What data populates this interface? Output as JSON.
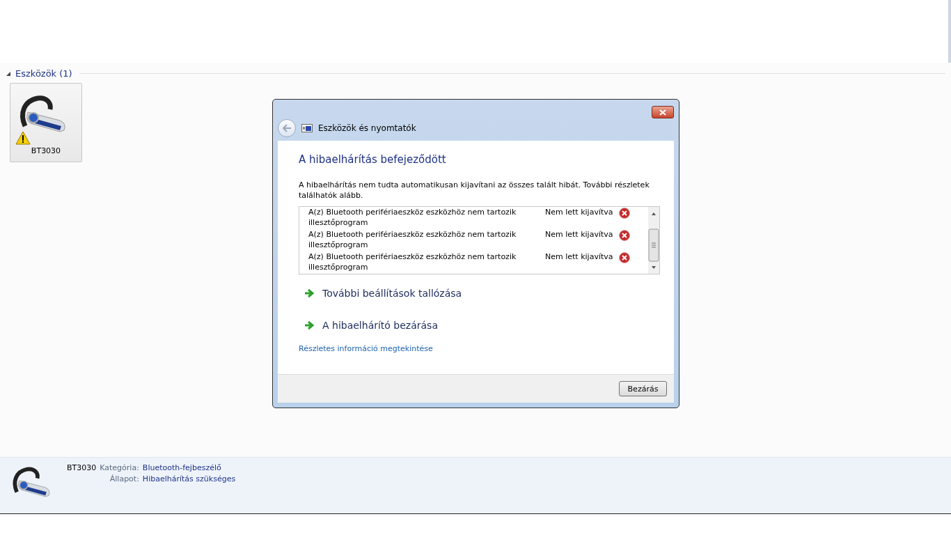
{
  "group": {
    "title": "Eszközök (1)",
    "expanded": true
  },
  "devices": [
    {
      "name": "BT3030",
      "warning": true,
      "selected": true
    }
  ],
  "details": {
    "name": "BT3030",
    "fields": [
      {
        "label": "Kategória:",
        "value": "Bluetooth-fejbeszélő"
      },
      {
        "label": "Állapot:",
        "value": "Hibaelhárítás szükséges"
      }
    ]
  },
  "dialog": {
    "title": "Eszközök és nyomtatók",
    "heading": "A hibaelhárítás befejeződött",
    "message": "A hibaelhárítás nem tudta automatikusan kijavítani az összes talált hibát. További részletek találhatók alább.",
    "problems": [
      {
        "text": "A(z) Bluetooth perifériaeszköz eszközhöz nem tartozik illesztőprogram",
        "status": "Nem lett kijavítva",
        "fixed": false
      },
      {
        "text": "A(z) Bluetooth perifériaeszköz eszközhöz nem tartozik illesztőprogram",
        "status": "Nem lett kijavítva",
        "fixed": false
      },
      {
        "text": "A(z) Bluetooth perifériaeszköz eszközhöz nem tartozik illesztőprogram",
        "status": "Nem lett kijavítva",
        "fixed": false
      }
    ],
    "actions": [
      "További beállítások tallózása",
      "A hibaelhárító bezárása"
    ],
    "link": "Részletes információ megtekintése",
    "button": "Bezárás"
  }
}
